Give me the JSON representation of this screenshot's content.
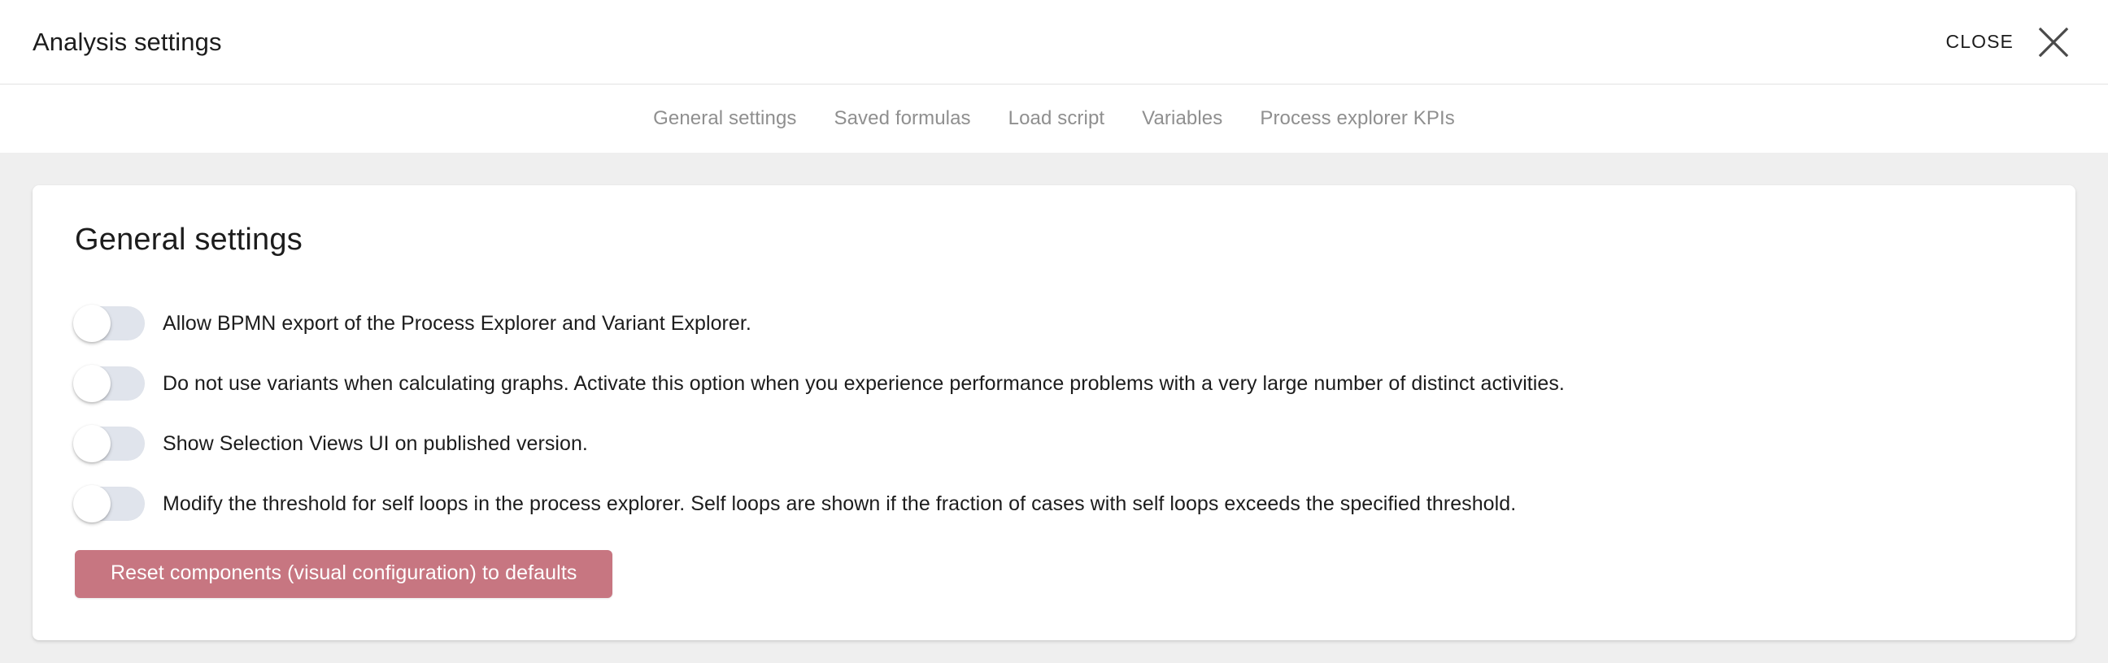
{
  "header": {
    "title": "Analysis settings",
    "close_label": "CLOSE",
    "close_icon": "close-x-icon"
  },
  "tabs": [
    {
      "label": "General settings",
      "active": true
    },
    {
      "label": "Saved formulas",
      "active": false
    },
    {
      "label": "Load script",
      "active": false
    },
    {
      "label": "Variables",
      "active": false
    },
    {
      "label": "Process explorer KPIs",
      "active": false
    }
  ],
  "card": {
    "title": "General settings",
    "settings": [
      {
        "toggle_state": "off",
        "label": "Allow BPMN export of the Process Explorer and Variant Explorer."
      },
      {
        "toggle_state": "off",
        "label": "Do not use variants when calculating graphs. Activate this option when you experience performance problems with a very large number of distinct activities."
      },
      {
        "toggle_state": "off",
        "label": "Show Selection Views UI on published version."
      },
      {
        "toggle_state": "off",
        "label": "Modify the threshold for self loops in the process explorer. Self loops are shown if the fraction of cases with self loops exceeds the specified threshold."
      }
    ],
    "reset_button_label": "Reset components (visual configuration) to defaults"
  },
  "colors": {
    "page_background": "#efefef",
    "card_background": "#ffffff",
    "toggle_track_off": "#e0e4ec",
    "toggle_knob": "#ffffff",
    "reset_button": "#c77681",
    "tab_text": "#8f8f8f",
    "primary_text": "#1c1c1c"
  }
}
